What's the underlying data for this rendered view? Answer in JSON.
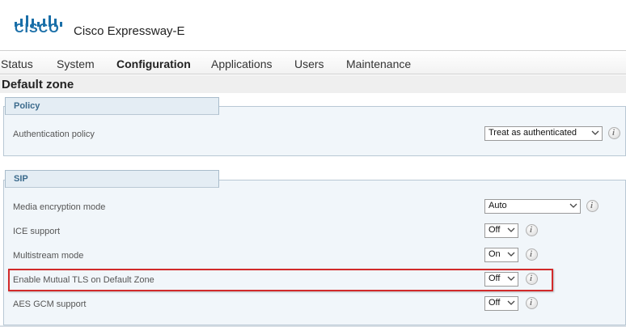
{
  "header": {
    "logo_text": "CISCO",
    "product_name": "Cisco Expressway-E"
  },
  "nav": {
    "items": [
      {
        "label": "Status"
      },
      {
        "label": "System"
      },
      {
        "label": "Configuration"
      },
      {
        "label": "Applications"
      },
      {
        "label": "Users"
      },
      {
        "label": "Maintenance"
      }
    ],
    "active": "Configuration"
  },
  "page": {
    "title": "Default zone"
  },
  "sections": {
    "policy": {
      "title": "Policy",
      "rows": [
        {
          "label": "Authentication policy",
          "value": "Treat as authenticated"
        }
      ]
    },
    "sip": {
      "title": "SIP",
      "rows": [
        {
          "label": "Media encryption mode",
          "value": "Auto"
        },
        {
          "label": "ICE support",
          "value": "Off"
        },
        {
          "label": "Multistream mode",
          "value": "On"
        },
        {
          "label": "Enable Mutual TLS on Default Zone",
          "value": "Off"
        },
        {
          "label": "AES GCM support",
          "value": "Off"
        }
      ]
    }
  },
  "icons": {
    "info": "info-icon",
    "dropdown": "chevron-down-icon"
  },
  "colors": {
    "brand": "#1a6fa8",
    "highlight": "#d22a2a",
    "section_title": "#3b6a8c"
  }
}
